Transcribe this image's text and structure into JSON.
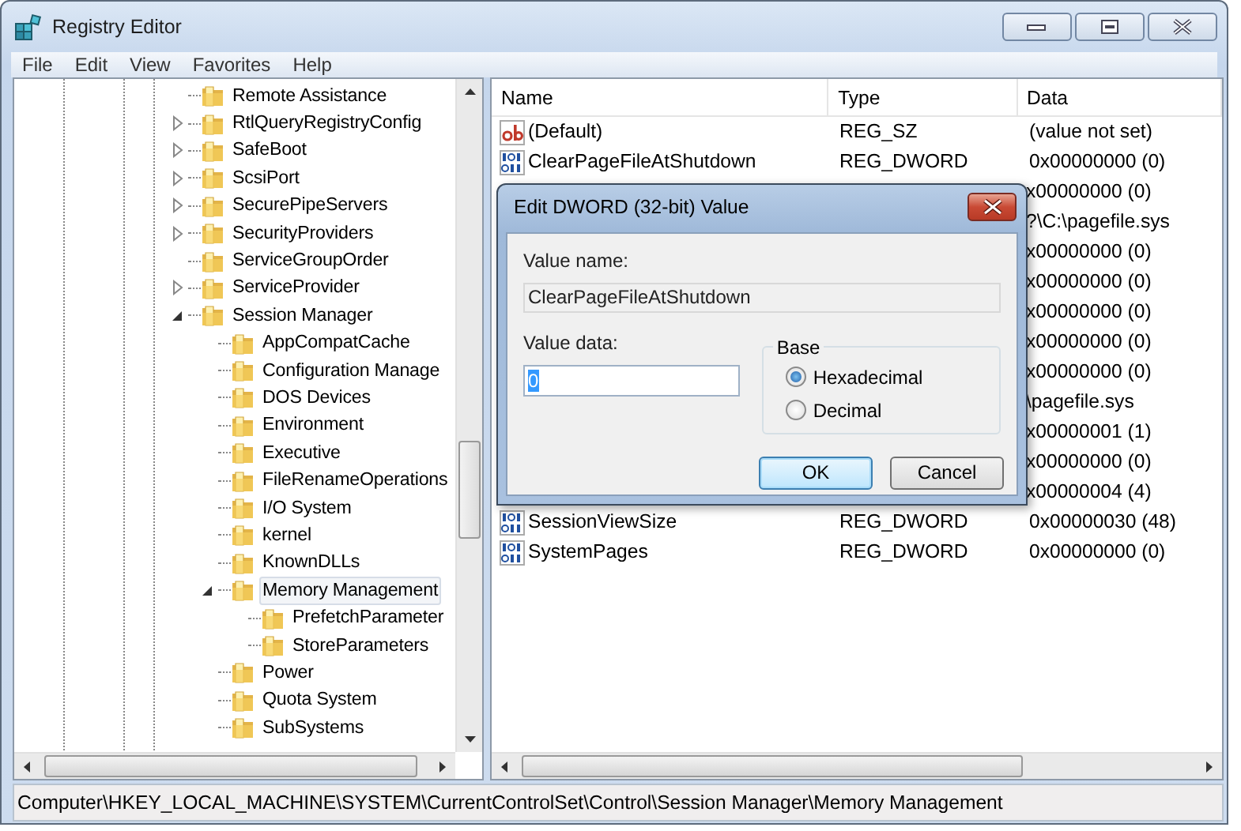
{
  "window": {
    "title": "Registry Editor"
  },
  "menu": [
    "File",
    "Edit",
    "View",
    "Favorites",
    "Help"
  ],
  "tree": [
    {
      "label": "Remote Assistance",
      "has_children": false,
      "selected": false
    },
    {
      "label": "RtlQueryRegistryConfig",
      "has_children": true,
      "expanded": false,
      "selected": false
    },
    {
      "label": "SafeBoot",
      "has_children": true,
      "expanded": false,
      "selected": false
    },
    {
      "label": "ScsiPort",
      "has_children": true,
      "expanded": false,
      "selected": false
    },
    {
      "label": "SecurePipeServers",
      "has_children": true,
      "expanded": false,
      "selected": false
    },
    {
      "label": "SecurityProviders",
      "has_children": true,
      "expanded": false,
      "selected": false
    },
    {
      "label": "ServiceGroupOrder",
      "has_children": false,
      "selected": false
    },
    {
      "label": "ServiceProvider",
      "has_children": true,
      "expanded": false,
      "selected": false
    },
    {
      "label": "Session Manager",
      "has_children": true,
      "expanded": true,
      "selected": false,
      "children": [
        {
          "label": "AppCompatCache",
          "has_children": false,
          "selected": false
        },
        {
          "label": "Configuration Manage",
          "has_children": false,
          "selected": false
        },
        {
          "label": "DOS Devices",
          "has_children": false,
          "selected": false
        },
        {
          "label": "Environment",
          "has_children": false,
          "selected": false
        },
        {
          "label": "Executive",
          "has_children": false,
          "selected": false
        },
        {
          "label": "FileRenameOperations",
          "has_children": false,
          "selected": false
        },
        {
          "label": "I/O System",
          "has_children": false,
          "selected": false
        },
        {
          "label": "kernel",
          "has_children": false,
          "selected": false
        },
        {
          "label": "KnownDLLs",
          "has_children": false,
          "selected": false
        },
        {
          "label": "Memory Management",
          "has_children": true,
          "expanded": true,
          "selected": true,
          "children": [
            {
              "label": "PrefetchParameter",
              "has_children": false,
              "selected": false
            },
            {
              "label": "StoreParameters",
              "has_children": false,
              "selected": false
            }
          ]
        },
        {
          "label": "Power",
          "has_children": false,
          "selected": false
        },
        {
          "label": "Quota System",
          "has_children": false,
          "selected": false
        },
        {
          "label": "SubSystems",
          "has_children": false,
          "selected": false
        }
      ]
    }
  ],
  "list": {
    "columns": [
      "Name",
      "Type",
      "Data"
    ],
    "rows": [
      {
        "kind": "string",
        "name": "(Default)",
        "type": "REG_SZ",
        "data": "(value not set)"
      },
      {
        "kind": "dword",
        "name": "ClearPageFileAtShutdown",
        "type": "REG_DWORD",
        "data": "0x00000000 (0)"
      },
      {
        "kind": "covered",
        "data": "x00000000 (0)"
      },
      {
        "kind": "covered",
        "data": "?\\C:\\pagefile.sys"
      },
      {
        "kind": "covered",
        "data": "x00000000 (0)"
      },
      {
        "kind": "covered",
        "data": "x00000000 (0)"
      },
      {
        "kind": "covered",
        "data": "x00000000 (0)"
      },
      {
        "kind": "covered",
        "data": "x00000000 (0)"
      },
      {
        "kind": "covered",
        "data": "x00000000 (0)"
      },
      {
        "kind": "covered",
        "data": "\\pagefile.sys"
      },
      {
        "kind": "covered",
        "data": "x00000001 (1)"
      },
      {
        "kind": "covered",
        "data": "x00000000 (0)"
      },
      {
        "kind": "covered",
        "data": "x00000004 (4)"
      },
      {
        "kind": "dword",
        "name": "SessionViewSize",
        "type": "REG_DWORD",
        "data": "0x00000030 (48)"
      },
      {
        "kind": "dword",
        "name": "SystemPages",
        "type": "REG_DWORD",
        "data": "0x00000000 (0)"
      }
    ]
  },
  "dialog": {
    "title": "Edit DWORD (32-bit) Value",
    "value_name_label": "Value name:",
    "value_name": "ClearPageFileAtShutdown",
    "value_data_label": "Value data:",
    "value_data": "0",
    "base_label": "Base",
    "base_options": [
      {
        "label": "Hexadecimal",
        "selected": true
      },
      {
        "label": "Decimal",
        "selected": false
      }
    ],
    "buttons": [
      {
        "label": "OK",
        "default": true
      },
      {
        "label": "Cancel",
        "default": false
      }
    ]
  },
  "status_bar": "Computer\\HKEY_LOCAL_MACHINE\\SYSTEM\\CurrentControlSet\\Control\\Session Manager\\Memory Management"
}
